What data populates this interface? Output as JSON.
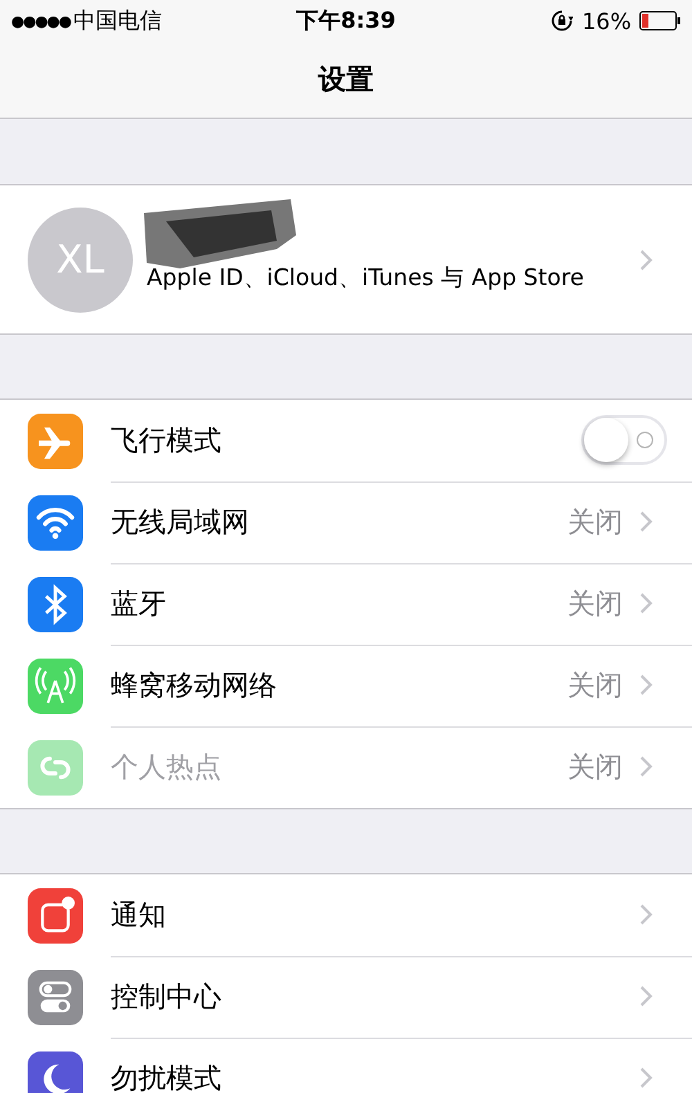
{
  "status_bar": {
    "signal": "●●●●●",
    "carrier": "中国电信",
    "time": "下午8:39",
    "battery": "16%"
  },
  "nav": {
    "title": "设置"
  },
  "profile": {
    "initials": "XL",
    "subtitle": "Apple ID、iCloud、iTunes 与 App Store"
  },
  "groups": [
    {
      "items": [
        {
          "kind": "toggle",
          "color": "#f7931e",
          "label": "飞行模式",
          "on": false,
          "disabled": false
        },
        {
          "kind": "link",
          "color": "#1a7cf2",
          "label": "无线局域网",
          "detail": "关闭",
          "disabled": false
        },
        {
          "kind": "link",
          "color": "#1a7cf2",
          "label": "蓝牙",
          "detail": "关闭",
          "disabled": false
        },
        {
          "kind": "link",
          "color": "#4cd964",
          "label": "蜂窝移动网络",
          "detail": "关闭",
          "disabled": false
        },
        {
          "kind": "link",
          "color": "#a6e8b2",
          "label": "个人热点",
          "detail": "关闭",
          "disabled": true
        }
      ]
    },
    {
      "items": [
        {
          "kind": "link",
          "color": "#f0413a",
          "label": "通知",
          "disabled": false
        },
        {
          "kind": "link",
          "color": "#8e8e93",
          "label": "控制中心",
          "disabled": false
        },
        {
          "kind": "link",
          "color": "#5856d6",
          "label": "勿扰模式",
          "disabled": false
        }
      ]
    }
  ]
}
